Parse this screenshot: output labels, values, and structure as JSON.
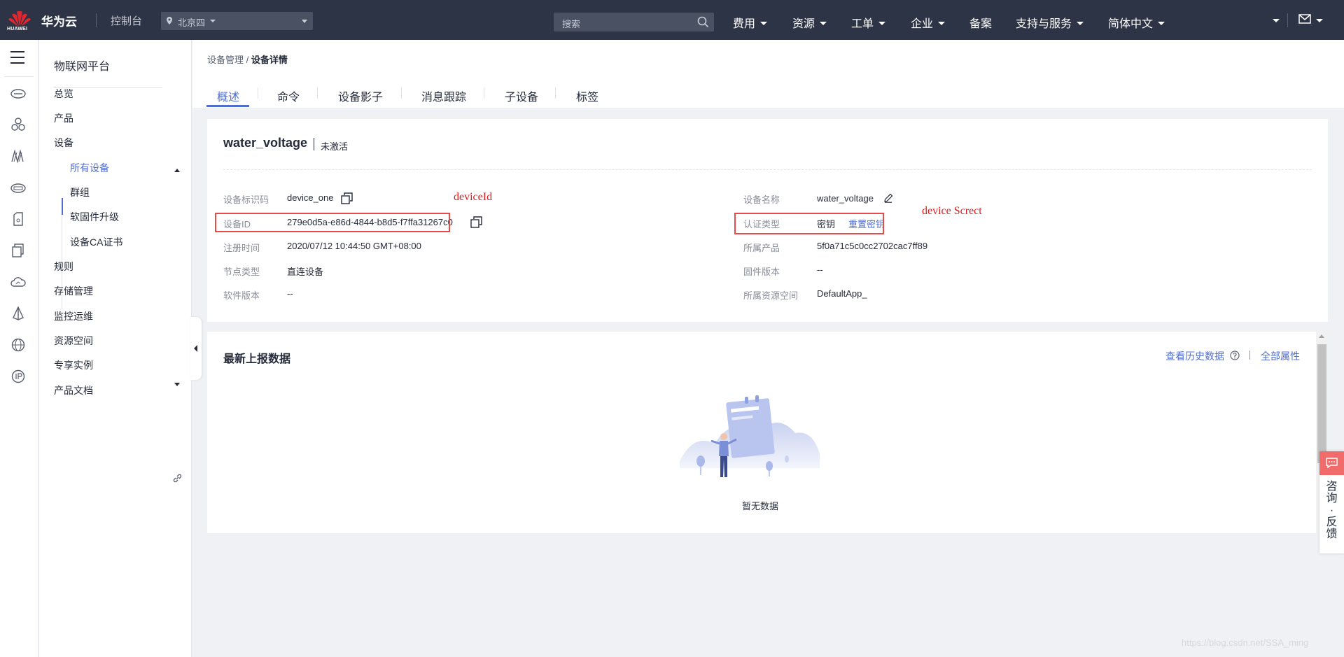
{
  "topbar": {
    "logo_text": "HUAWEI",
    "brand": "华为云",
    "console": "控制台",
    "region": "北京四",
    "search_placeholder": "搜索",
    "nav": [
      "费用",
      "资源",
      "工单",
      "企业",
      "备案",
      "支持与服务",
      "简体中文"
    ]
  },
  "sidebar": {
    "title": "物联网平台",
    "items": {
      "overview": "总览",
      "product": "产品",
      "device": "设备",
      "all_devices": "所有设备",
      "group": "群组",
      "firmware": "软固件升级",
      "ca_cert": "设备CA证书",
      "rules": "规则",
      "storage": "存储管理",
      "monitor": "监控运维",
      "resource_space": "资源空间",
      "exclusive": "专享实例",
      "docs": "产品文档"
    }
  },
  "breadcrumb": {
    "parent": "设备管理",
    "separator": " / ",
    "current": "设备详情"
  },
  "tabs": [
    "概述",
    "命令",
    "设备影子",
    "消息跟踪",
    "子设备",
    "标签"
  ],
  "device": {
    "name": "water_voltage",
    "status": "未激活",
    "fields": {
      "identifier_label": "设备标识码",
      "identifier_value": "device_one",
      "device_id_label": "设备ID",
      "device_id_value": "279e0d5a-e86d-4844-b8d5-f7ffa31267c0",
      "register_time_label": "注册时间",
      "register_time_value": "2020/07/12 10:44:50 GMT+08:00",
      "node_type_label": "节点类型",
      "node_type_value": "直连设备",
      "software_version_label": "软件版本",
      "software_version_value": "--",
      "device_name_label": "设备名称",
      "device_name_value": "water_voltage",
      "auth_type_label": "认证类型",
      "auth_type_value": "密钥",
      "reset_secret": "重置密钥",
      "product_label": "所属产品",
      "product_value": "5f0a71c5c0cc2702cac7ff89",
      "firmware_version_label": "固件版本",
      "firmware_version_value": "--",
      "resource_space_label": "所属资源空间",
      "resource_space_value": "DefaultApp_"
    }
  },
  "annotations": {
    "device_id": "deviceId",
    "device_secret": "device Screct"
  },
  "latest_data": {
    "title": "最新上报数据",
    "history_link": "查看历史数据",
    "all_props_link": "全部属性",
    "empty_text": "暂无数据"
  },
  "feedback": {
    "text": "咨询·反馈",
    "chars": [
      "咨",
      "询",
      "·",
      "反",
      "馈"
    ]
  },
  "watermark": "https://blog.csdn.net/SSA_ming",
  "colors": {
    "topbar": "#2d3445",
    "accent": "#526ecc",
    "annotation": "#e01b1b",
    "logo_red": "#e3262f",
    "feedback": "#f26b6b"
  }
}
